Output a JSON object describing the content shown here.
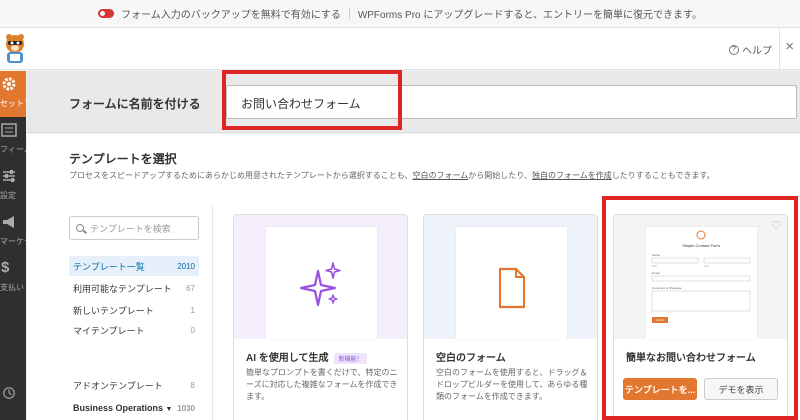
{
  "notice": {
    "toggle_label": "フォーム入力のバックアップを無料で有効にする",
    "upgrade_text": "WPForms Pro にアップグレードすると、エントリーを簡単に復元できます。"
  },
  "header": {
    "help_label": "ヘルプ",
    "close_symbol": "×"
  },
  "sidebar": {
    "items": [
      {
        "label": "セットアップ",
        "icon": "gear-icon"
      },
      {
        "label": "フィールド",
        "icon": "fields-icon"
      },
      {
        "label": "設定",
        "icon": "sliders-icon"
      },
      {
        "label": "マーケティング",
        "icon": "megaphone-icon"
      },
      {
        "label": "支払い",
        "icon": "dollar-icon"
      }
    ],
    "bottom_icon": "history-icon"
  },
  "name_row": {
    "label": "フォームに名前を付ける",
    "value": "お問い合わせフォーム"
  },
  "templates": {
    "title": "テンプレートを選択",
    "desc_part1": "プロセスをスピードアップするためにあらかじめ用意されたテンプレートから選択することも、",
    "desc_link1": "空白のフォーム",
    "desc_part2": "から開始したり、",
    "desc_link2": "独自のフォームを作成",
    "desc_part3": "したりすることもできます。",
    "search_placeholder": "テンプレートを検索",
    "categories": [
      {
        "label": "テンプレート一覧",
        "count": "2010"
      },
      {
        "label": "利用可能なテンプレート",
        "count": "67"
      },
      {
        "label": "新しいテンプレート",
        "count": "1"
      },
      {
        "label": "マイテンプレート",
        "count": "0"
      },
      {
        "label": "アドオンテンプレート",
        "count": "8"
      },
      {
        "label": "Business Operations",
        "count": "1030"
      }
    ],
    "cards": [
      {
        "title": "AI を使用して生成",
        "badge": "新機能！",
        "desc": "簡単なプロンプトを書くだけで、特定のニーズに対応した複雑なフォームを作成できます。"
      },
      {
        "title": "空白のフォーム",
        "desc": "空白のフォームを使用すると、ドラッグ＆ドロップビルダーを使用して、あらゆる種類のフォームを作成できます。"
      },
      {
        "title": "簡単なお問い合わせフォーム",
        "btn_use": "テンプレートを...",
        "btn_demo": "デモを表示",
        "preview": {
          "title": "Simple Contact Form",
          "name": "Name",
          "first": "First",
          "last": "Last",
          "email": "Email",
          "message": "Comment or Message",
          "submit": "Submit"
        }
      }
    ]
  },
  "colors": {
    "accent": "#e27730",
    "highlight": "#e02525",
    "sidebar_bg": "#2f2f2f",
    "link": "#036aab"
  }
}
